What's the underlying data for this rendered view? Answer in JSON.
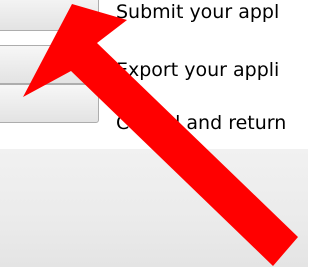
{
  "dialog": {
    "commands": [
      {
        "button_label": "",
        "description": "Submit your appl"
      },
      {
        "button_label": "",
        "description": "Export your appli"
      },
      {
        "button_label": "",
        "description": "Cancel and return"
      }
    ]
  },
  "overlay": {
    "arrow_color": "#ff0000",
    "icon": "arrow-pointer-icon"
  }
}
